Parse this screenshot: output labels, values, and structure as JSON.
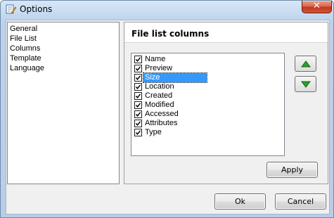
{
  "window": {
    "title": "Options",
    "close_symbol": "✕",
    "title_icon": "options-notepad-icon"
  },
  "nav": {
    "items": [
      {
        "label": "General"
      },
      {
        "label": "File List"
      },
      {
        "label": "Columns"
      },
      {
        "label": "Template"
      },
      {
        "label": "Language"
      }
    ]
  },
  "panel": {
    "title": "File list columns",
    "columns": [
      {
        "label": "Name",
        "checked": true,
        "selected": false
      },
      {
        "label": "Preview",
        "checked": true,
        "selected": false
      },
      {
        "label": "Size",
        "checked": true,
        "selected": true
      },
      {
        "label": "Location",
        "checked": true,
        "selected": false
      },
      {
        "label": "Created",
        "checked": true,
        "selected": false
      },
      {
        "label": "Modified",
        "checked": true,
        "selected": false
      },
      {
        "label": "Accessed",
        "checked": true,
        "selected": false
      },
      {
        "label": "Attributes",
        "checked": true,
        "selected": false
      },
      {
        "label": "Type",
        "checked": true,
        "selected": false
      }
    ],
    "move_up_icon": "arrow-up-icon",
    "move_down_icon": "arrow-down-icon",
    "apply_label": "Apply"
  },
  "footer": {
    "ok_label": "Ok",
    "cancel_label": "Cancel"
  },
  "colors": {
    "selection": "#3399ff",
    "arrow_green": "#2e9e2e",
    "close_red": "#c3381b"
  }
}
